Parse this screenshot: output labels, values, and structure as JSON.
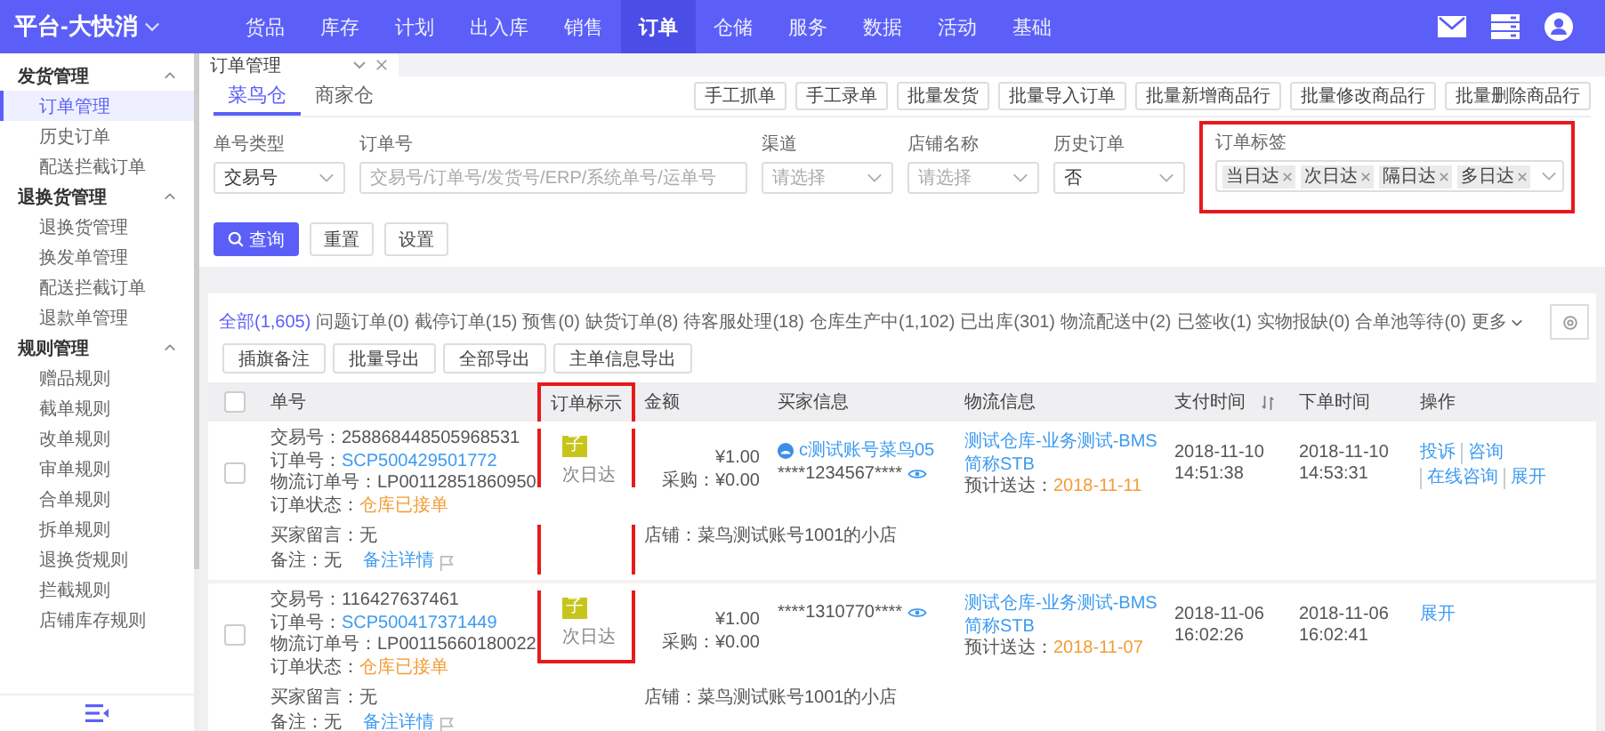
{
  "top_nav": {
    "brand": "平台-大快消",
    "items": [
      {
        "label": "货品",
        "selected": false
      },
      {
        "label": "库存",
        "selected": false
      },
      {
        "label": "计划",
        "selected": false
      },
      {
        "label": "出入库",
        "selected": false
      },
      {
        "label": "销售",
        "selected": false
      },
      {
        "label": "订单",
        "selected": true
      },
      {
        "label": "仓储",
        "selected": false
      },
      {
        "label": "服务",
        "selected": false
      },
      {
        "label": "数据",
        "selected": false
      },
      {
        "label": "活动",
        "selected": false
      },
      {
        "label": "基础",
        "selected": false
      }
    ]
  },
  "sidebar": {
    "groups": [
      {
        "title": "发货管理",
        "expanded": true,
        "items": [
          {
            "label": "订单管理",
            "selected": true
          },
          {
            "label": "历史订单",
            "selected": false
          },
          {
            "label": "配送拦截订单",
            "selected": false
          }
        ]
      },
      {
        "title": "退换货管理",
        "expanded": true,
        "items": [
          {
            "label": "退换货管理",
            "selected": false
          },
          {
            "label": "换发单管理",
            "selected": false
          },
          {
            "label": "配送拦截订单",
            "selected": false
          },
          {
            "label": "退款单管理",
            "selected": false
          }
        ]
      },
      {
        "title": "规则管理",
        "expanded": true,
        "items": [
          {
            "label": "赠品规则",
            "selected": false
          },
          {
            "label": "截单规则",
            "selected": false
          },
          {
            "label": "改单规则",
            "selected": false
          },
          {
            "label": "审单规则",
            "selected": false
          },
          {
            "label": "合单规则",
            "selected": false
          },
          {
            "label": "拆单规则",
            "selected": false
          },
          {
            "label": "退换货规则",
            "selected": false
          },
          {
            "label": "拦截规则",
            "selected": false
          },
          {
            "label": "店铺库存规则",
            "selected": false
          }
        ]
      }
    ]
  },
  "page_tabs": [
    {
      "label": "订单管理"
    }
  ],
  "warehouse_tabs": [
    {
      "label": "菜鸟仓",
      "selected": true
    },
    {
      "label": "商家仓",
      "selected": false
    }
  ],
  "toolbar_buttons": [
    "手工抓单",
    "手工录单",
    "批量发货",
    "批量导入订单",
    "批量新增商品行",
    "批量修改商品行",
    "批量删除商品行"
  ],
  "filters": [
    {
      "kind": "select",
      "label": "单号类型",
      "value": "交易号"
    },
    {
      "kind": "input",
      "label": "订单号",
      "placeholder": "交易号/订单号/发货号/ERP/系统单号/运单号"
    },
    {
      "kind": "select",
      "label": "渠道",
      "placeholder": "请选择"
    },
    {
      "kind": "select",
      "label": "店铺名称",
      "placeholder": "请选择"
    },
    {
      "kind": "select",
      "label": "历史订单",
      "value": "否"
    },
    {
      "kind": "tags",
      "label": "订单标签",
      "highlighted": true,
      "tags": [
        "当日达",
        "次日达",
        "隔日达",
        "多日达"
      ]
    }
  ],
  "filter_buttons": [
    {
      "kind": "primary",
      "label": "查询"
    },
    {
      "kind": "default",
      "label": "重置"
    },
    {
      "kind": "default",
      "label": "设置"
    }
  ],
  "status_tabs": [
    {
      "label": "全部(1,605)",
      "selected": true
    },
    {
      "label": "问题订单(0)",
      "selected": false
    },
    {
      "label": "截停订单(15)",
      "selected": false
    },
    {
      "label": "预售(0)",
      "selected": false
    },
    {
      "label": "缺货订单(8)",
      "selected": false
    },
    {
      "label": "待客服处理(18)",
      "selected": false
    },
    {
      "label": "仓库生产中(1,102)",
      "selected": false
    },
    {
      "label": "已出库(301)",
      "selected": false
    },
    {
      "label": "物流配送中(2)",
      "selected": false
    },
    {
      "label": "已签收(1)",
      "selected": false
    },
    {
      "label": "实物报缺(0)",
      "selected": false
    },
    {
      "label": "合单池等待(0)",
      "selected": false
    }
  ],
  "more_label": "更多",
  "action_buttons": [
    "插旗备注",
    "批量导出",
    "全部导出",
    "主单信息导出"
  ],
  "table": {
    "select_all_checked": false,
    "columns": [
      {
        "label": "单号",
        "highlighted": false,
        "sortable": false
      },
      {
        "label": "订单标示",
        "highlighted": true,
        "sortable": false
      },
      {
        "label": "金额",
        "highlighted": false,
        "sortable": false
      },
      {
        "label": "买家信息",
        "highlighted": false,
        "sortable": false
      },
      {
        "label": "物流信息",
        "highlighted": false,
        "sortable": false
      },
      {
        "label": "支付时间",
        "highlighted": false,
        "sortable": true
      },
      {
        "label": "下单时间",
        "highlighted": false,
        "sortable": false
      },
      {
        "label": "操作",
        "highlighted": false,
        "sortable": false
      }
    ],
    "rows": [
      {
        "checked": false,
        "lines": [
          {
            "label": "交易号：",
            "value": "258868448505968531",
            "kind": "plain"
          },
          {
            "label": "订单号：",
            "value": "SCP500429501772",
            "kind": "link"
          },
          {
            "label": "物流订单号：",
            "value": "LP00112851860950",
            "kind": "plain"
          },
          {
            "label": "订单状态：",
            "value": "仓库已接单",
            "kind": "status"
          }
        ],
        "tag": {
          "badge": "子",
          "label": "次日达"
        },
        "amount": [
          "¥1.00",
          "采购：¥0.00"
        ],
        "buyer": {
          "name": "c测试账号菜鸟05",
          "phone": "****1234567****"
        },
        "logistics": {
          "warehouse": "测试仓库-业务测试-BMS",
          "short": "简称STB",
          "eta_label": "预计送达：",
          "eta": "2018-11-11"
        },
        "pay_time": [
          "2018-11-10",
          "14:51:38"
        ],
        "order_time": [
          "2018-11-10",
          "14:53:31"
        ],
        "actions": [
          "投诉",
          "咨询",
          "在线咨询",
          "展开"
        ],
        "buyer_message": "买家留言：无",
        "remark": "备注：无",
        "remark_link": "备注详情",
        "shop": "店铺：菜鸟测试账号1001的小店"
      },
      {
        "checked": false,
        "lines": [
          {
            "label": "交易号：",
            "value": "116427637461",
            "kind": "plain"
          },
          {
            "label": "订单号：",
            "value": "SCP500417371449",
            "kind": "link"
          },
          {
            "label": "物流订单号：",
            "value": "LP00115660180022",
            "kind": "plain"
          },
          {
            "label": "订单状态：",
            "value": "仓库已接单",
            "kind": "status"
          }
        ],
        "tag": {
          "badge": "子",
          "label": "次日达"
        },
        "amount": [
          "¥1.00",
          "采购：¥0.00"
        ],
        "buyer": {
          "phone": "****1310770****"
        },
        "logistics": {
          "warehouse": "测试仓库-业务测试-BMS",
          "short": "简称STB",
          "eta_label": "预计送达：",
          "eta": "2018-11-07"
        },
        "pay_time": [
          "2018-11-06",
          "16:02:26"
        ],
        "order_time": [
          "2018-11-06",
          "16:02:41"
        ],
        "actions": [
          "展开"
        ],
        "buyer_message": "买家留言：无",
        "remark": "备注：无",
        "remark_link": "备注详情",
        "shop": "店铺：菜鸟测试账号1001的小店"
      }
    ]
  }
}
